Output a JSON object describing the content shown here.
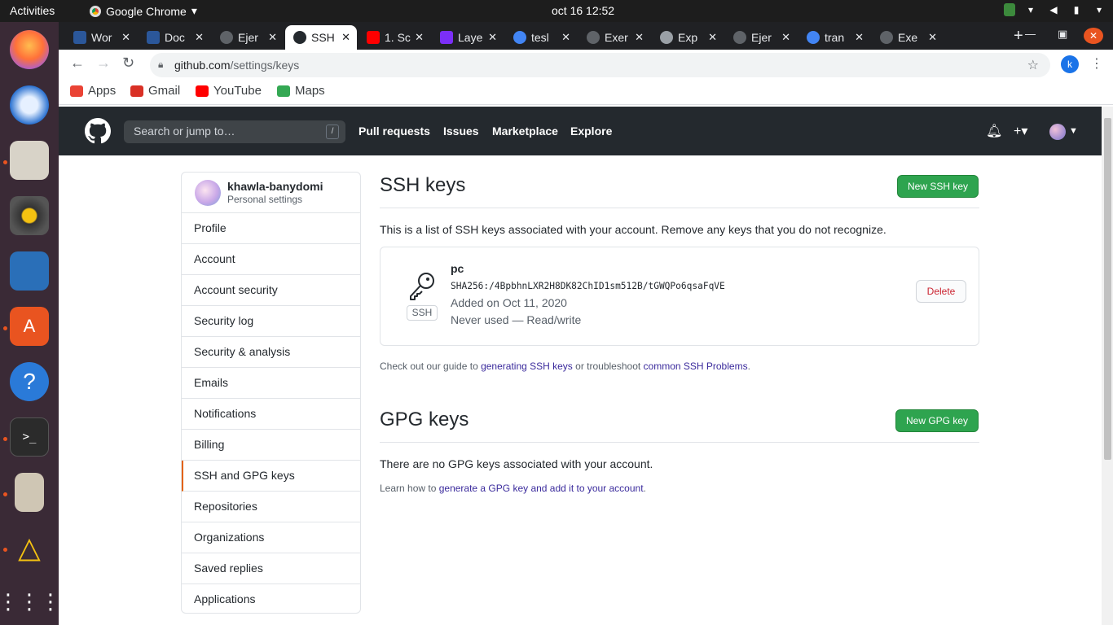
{
  "system": {
    "activities": "Activities",
    "app_name": "Google Chrome",
    "clock": "oct 16  12:52"
  },
  "browser": {
    "tabs": [
      {
        "title": "Wor",
        "icon": "word-icon",
        "color": "#2b579a"
      },
      {
        "title": "Doc",
        "icon": "word-icon",
        "color": "#2b579a"
      },
      {
        "title": "Ejer",
        "icon": "github-icon",
        "color": "#5f6368"
      },
      {
        "title": "SSH",
        "icon": "github-icon",
        "color": "#24292e"
      },
      {
        "title": "1. Sc",
        "icon": "youtube-icon",
        "color": "#ff0000"
      },
      {
        "title": "Laye",
        "icon": "layer-icon",
        "color": "#7b2ff7"
      },
      {
        "title": "tesl",
        "icon": "google-icon",
        "color": "#4285f4"
      },
      {
        "title": "Exer",
        "icon": "github-icon",
        "color": "#5f6368"
      },
      {
        "title": "Exp",
        "icon": "gear-icon",
        "color": "#9aa0a6"
      },
      {
        "title": "Ejer",
        "icon": "github-icon",
        "color": "#5f6368"
      },
      {
        "title": "tran",
        "icon": "google-icon",
        "color": "#4285f4"
      },
      {
        "title": "Exe",
        "icon": "github-icon",
        "color": "#5f6368"
      }
    ],
    "active_tab_index": 3,
    "url_host": "github.com",
    "url_path": "/settings/keys",
    "profile_initial": "k",
    "bookmarks": [
      {
        "label": "Apps",
        "color": "#ea4335"
      },
      {
        "label": "Gmail",
        "color": "#d93025"
      },
      {
        "label": "YouTube",
        "color": "#ff0000"
      },
      {
        "label": "Maps",
        "color": "#34a853"
      }
    ]
  },
  "github": {
    "search_placeholder": "Search or jump to…",
    "search_shortcut": "/",
    "nav": [
      "Pull requests",
      "Issues",
      "Marketplace",
      "Explore"
    ]
  },
  "sidebar": {
    "username": "khawla-banydomi",
    "subtitle": "Personal settings",
    "items": [
      "Profile",
      "Account",
      "Account security",
      "Security log",
      "Security & analysis",
      "Emails",
      "Notifications",
      "Billing",
      "SSH and GPG keys",
      "Repositories",
      "Organizations",
      "Saved replies",
      "Applications"
    ],
    "selected_index": 8
  },
  "ssh": {
    "title": "SSH keys",
    "new_button": "New SSH key",
    "description": "This is a list of SSH keys associated with your account. Remove any keys that you do not recognize.",
    "key": {
      "name": "pc",
      "type_label": "SSH",
      "fingerprint": "SHA256:/4BpbhnLXR2H8DK82ChID1sm512B/tGWQPo6qsaFqVE",
      "added": "Added on Oct 11, 2020",
      "usage": "Never used — Read/write",
      "delete_label": "Delete"
    },
    "help_prefix": "Check out our guide to ",
    "help_link1": "generating SSH keys",
    "help_middle": " or troubleshoot ",
    "help_link2": "common SSH Problems",
    "help_suffix": "."
  },
  "gpg": {
    "title": "GPG keys",
    "new_button": "New GPG key",
    "empty_text": "There are no GPG keys associated with your account.",
    "learn_prefix": "Learn how to ",
    "learn_link": "generate a GPG key and add it to your account",
    "learn_suffix": "."
  },
  "colors": {
    "accent_green": "#2ea44f",
    "delete_red": "#cb2431",
    "selected_marker": "#e36209",
    "github_header": "#24292e"
  }
}
